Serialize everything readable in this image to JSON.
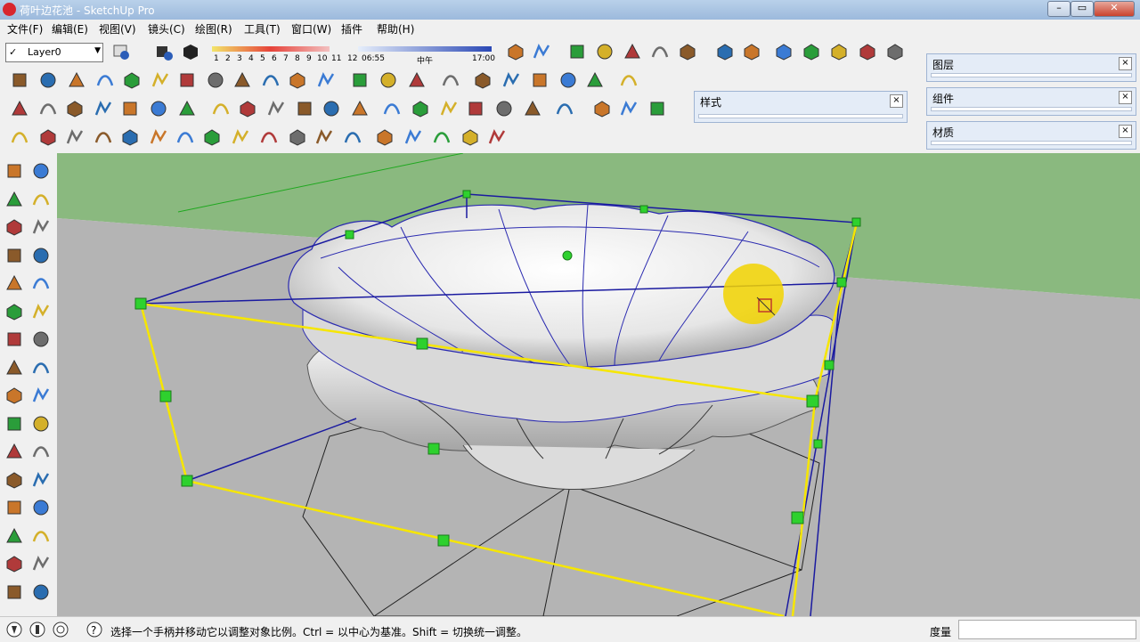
{
  "window": {
    "title": "荷叶边花池 - SketchUp Pro"
  },
  "menu": [
    "文件(F)",
    "编辑(E)",
    "视图(V)",
    "镜头(C)",
    "绘图(R)",
    "工具(T)",
    "窗口(W)",
    "插件",
    "帮助(H)"
  ],
  "layer": {
    "current": "Layer0"
  },
  "shadow_settings": {
    "month_numbers": [
      "1",
      "2",
      "3",
      "4",
      "5",
      "6",
      "7",
      "8",
      "9",
      "10",
      "11",
      "12"
    ],
    "time_start": "06:55",
    "time_mid": "中午",
    "time_end": "17:00"
  },
  "panels": {
    "styles": "样式",
    "layers": "图层",
    "components": "组件",
    "materials": "材质"
  },
  "status": {
    "hint": "选择一个手柄并移动它以调整对象比例。Ctrl = 以中心为基准。Shift = 切换统一调整。",
    "measure_label": "度量",
    "measure_value": ""
  },
  "colors": {
    "sky": "#8ab97f",
    "ground": "#b4b4b4",
    "selection": "#f6e600",
    "bbox_edge": "#1a1aa0",
    "grip": "#2ed12e"
  }
}
